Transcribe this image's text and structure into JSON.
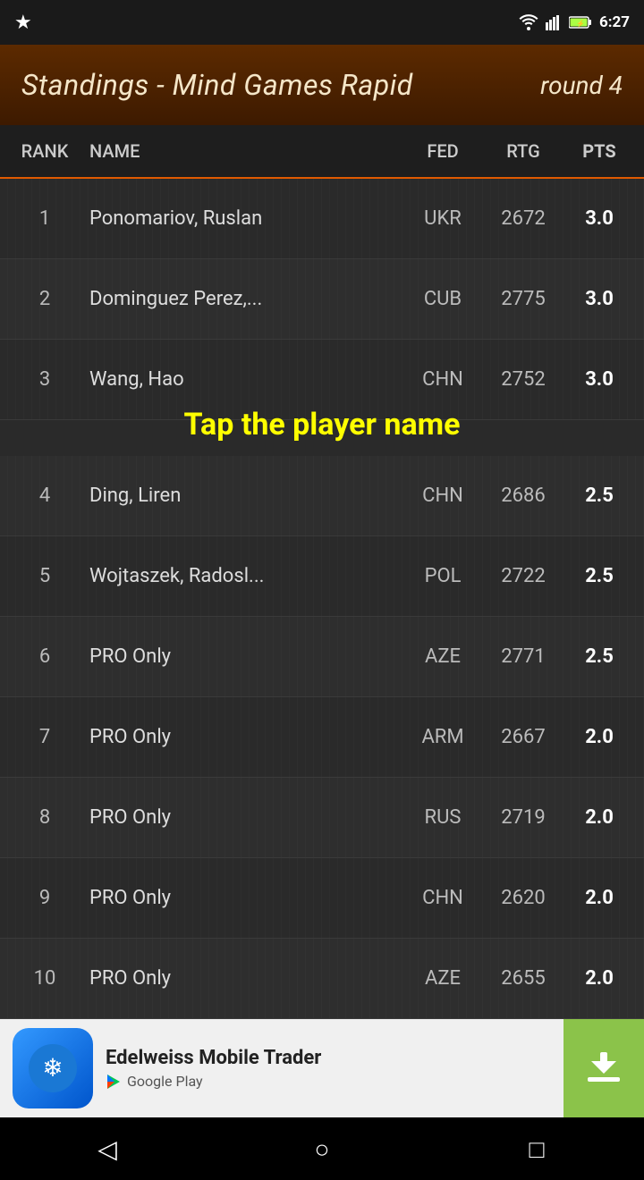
{
  "statusBar": {
    "time": "6:27",
    "leftIcon": "★"
  },
  "header": {
    "title": "Standings - Mind Games Rapid",
    "round": "round 4"
  },
  "columns": {
    "rank": "RANK",
    "name": "NAME",
    "fed": "FED",
    "rtg": "RTG",
    "pts": "PTS"
  },
  "tapHint": "Tap the player name",
  "rows": [
    {
      "rank": "1",
      "name": "Ponomariov, Ruslan",
      "fed": "UKR",
      "rtg": "2672",
      "pts": "3.0"
    },
    {
      "rank": "2",
      "name": "Dominguez Perez,...",
      "fed": "CUB",
      "rtg": "2775",
      "pts": "3.0"
    },
    {
      "rank": "3",
      "name": "Wang, Hao",
      "fed": "CHN",
      "rtg": "2752",
      "pts": "3.0"
    },
    {
      "rank": "4",
      "name": "Ding, Liren",
      "fed": "CHN",
      "rtg": "2686",
      "pts": "2.5"
    },
    {
      "rank": "5",
      "name": "Wojtaszek, Radosl...",
      "fed": "POL",
      "rtg": "2722",
      "pts": "2.5"
    },
    {
      "rank": "6",
      "name": "PRO Only",
      "fed": "AZE",
      "rtg": "2771",
      "pts": "2.5"
    },
    {
      "rank": "7",
      "name": "PRO Only",
      "fed": "ARM",
      "rtg": "2667",
      "pts": "2.0"
    },
    {
      "rank": "8",
      "name": "PRO Only",
      "fed": "RUS",
      "rtg": "2719",
      "pts": "2.0"
    },
    {
      "rank": "9",
      "name": "PRO Only",
      "fed": "CHN",
      "rtg": "2620",
      "pts": "2.0"
    },
    {
      "rank": "10",
      "name": "PRO Only",
      "fed": "AZE",
      "rtg": "2655",
      "pts": "2.0"
    }
  ],
  "ad": {
    "title": "Edelweiss Mobile Trader",
    "subtitle": "Google Play",
    "iconSymbol": "❄"
  },
  "navBar": {
    "backLabel": "◁",
    "homeLabel": "○",
    "recentLabel": "□"
  }
}
